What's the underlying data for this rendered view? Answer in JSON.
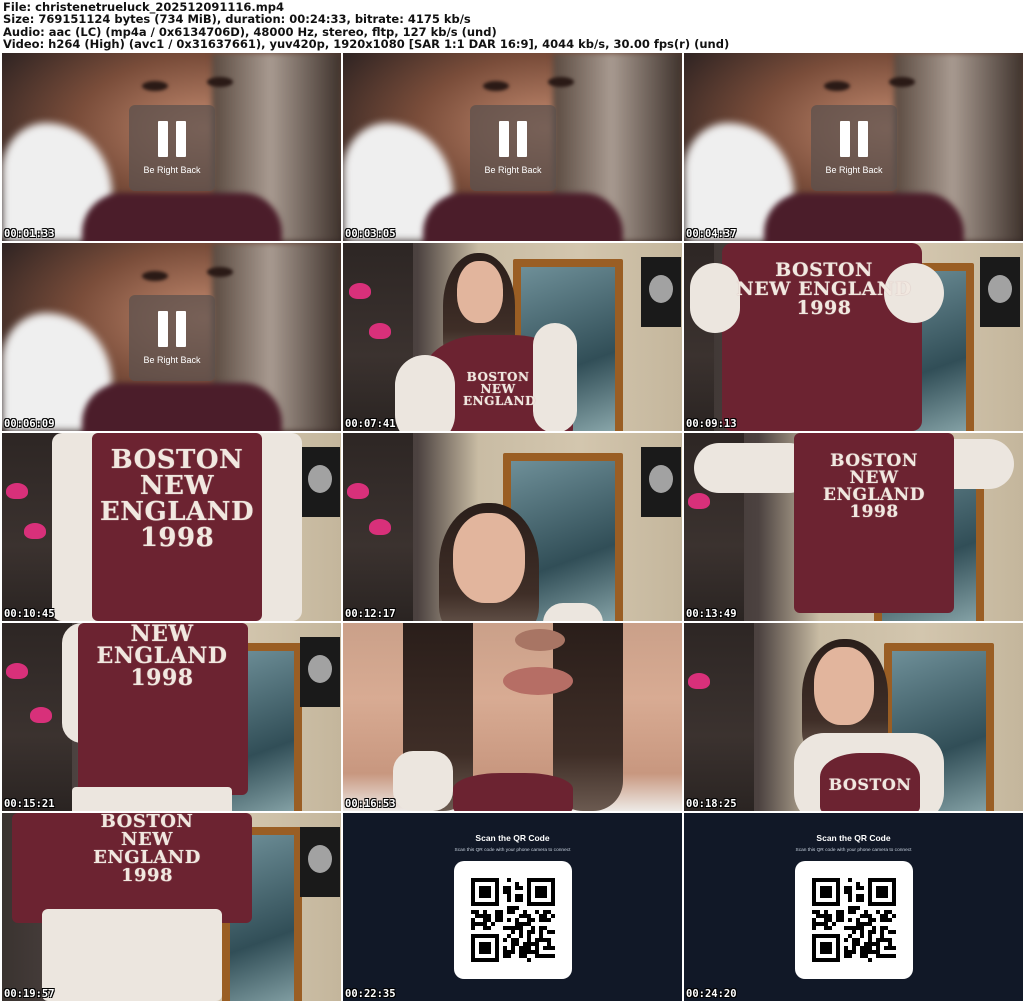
{
  "header": {
    "file_line": "File: christenetrueluck_202512091116.mp4",
    "size_line": "Size: 769151124 bytes (734 MiB), duration: 00:24:33, bitrate: 4175 kb/s",
    "audio_line": "Audio: aac (LC) (mp4a / 0x6134706D), 48000 Hz, stereo, fltp, 127 kb/s (und)",
    "video_line": "Video: h264 (High) (avc1 / 0x31637661), yuv420p, 1920x1080 [SAR 1:1 DAR 16:9], 4044 kb/s, 30.00 fps(r) (und)"
  },
  "brb_label": "Be Right Back",
  "sweatshirt": {
    "line1": "BOSTON",
    "line2": "NEW ENGLAND",
    "line3": "1998"
  },
  "qr": {
    "title": "Scan the QR Code",
    "subtitle": "Scan this QR code with your phone camera to connect"
  },
  "thumbnails": [
    {
      "time": "00:01:33"
    },
    {
      "time": "00:03:05"
    },
    {
      "time": "00:04:37"
    },
    {
      "time": "00:06:09"
    },
    {
      "time": "00:07:41"
    },
    {
      "time": "00:09:13"
    },
    {
      "time": "00:10:45"
    },
    {
      "time": "00:12:17"
    },
    {
      "time": "00:13:49"
    },
    {
      "time": "00:15:21"
    },
    {
      "time": "00:16:53"
    },
    {
      "time": "00:18:25"
    },
    {
      "time": "00:19:57"
    },
    {
      "time": "00:22:35"
    },
    {
      "time": "00:24:20"
    }
  ],
  "colors": {
    "sweatshirt": "#6c2331",
    "qr_bg": "#111827",
    "door_frame": "#9a5e24"
  }
}
